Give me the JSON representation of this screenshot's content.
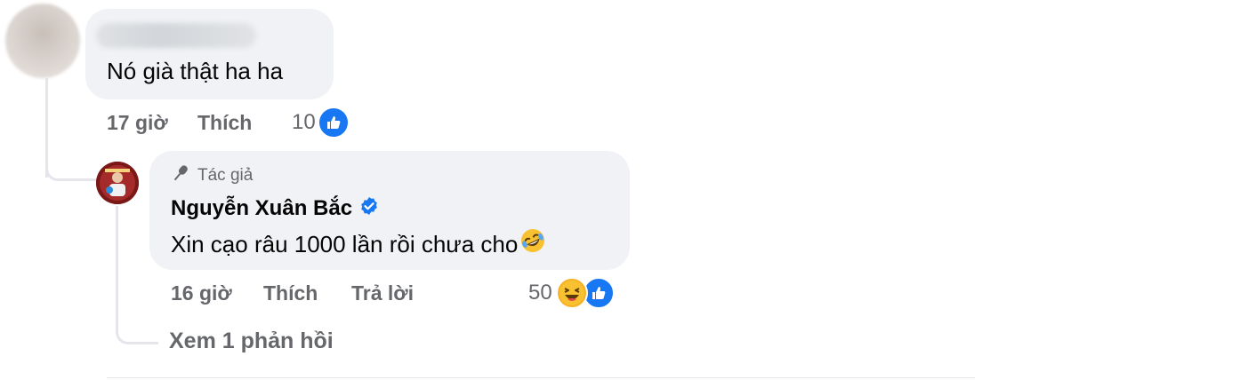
{
  "comment1": {
    "text": "Nó già thật ha ha",
    "time": "17 giờ",
    "like_label": "Thích",
    "reaction_count": "10"
  },
  "comment2": {
    "author_badge": "Tác giả",
    "author_name": "Nguyễn Xuân Bắc",
    "text": "Xin cạo râu 1000 lần rồi chưa cho",
    "time": "16 giờ",
    "like_label": "Thích",
    "reply_label": "Trả lời",
    "reaction_count": "50"
  },
  "see_replies": "Xem 1 phản hồi",
  "icons": {
    "author": "microphone-icon",
    "verified": "verified-badge-icon",
    "emoji": "rolling-laughing-emoji-icon",
    "reactions": [
      "like-icon",
      "haha-icon"
    ]
  },
  "colors": {
    "bubble": "#f0f2f5",
    "meta_text": "#65676b",
    "like_blue": "#1877f2",
    "verified_blue": "#1877f2"
  }
}
